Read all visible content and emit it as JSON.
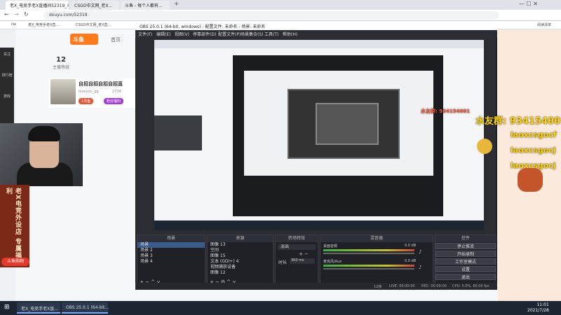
{
  "browser": {
    "tabs": [
      "老X_电竞手老X直播间52319_斗...",
      "CSGO中文网_老X...",
      "斗鱼 - 每个人都有..."
    ],
    "new_tab": "+",
    "url": "douyu.com/52319",
    "bookmarks": [
      "ilw",
      "老X_电竞手老X直...",
      "CSGO中文网_老X直..."
    ],
    "reading_list": "阅读清单"
  },
  "site": {
    "logo": "斗鱼",
    "nav": [
      "首页"
    ],
    "sidebar": [
      "关注",
      "排行榜",
      "游戏"
    ],
    "stats": [
      {
        "value": "12",
        "label": "主播等级"
      }
    ],
    "card_title": "自招自招自招自招直",
    "card_sub": "loveyou_gg",
    "card_count": "2734",
    "card_btn": "1月鱼",
    "card_btn2": "粉丝福利",
    "banner_text": "老X电竞外设店",
    "banner_text2": "专属福利",
    "shop_label": "斗鱼购物",
    "right_buttons": [
      "粉丝图片"
    ]
  },
  "obs": {
    "title": "OBS 25.0.1 (64-bit, windows) - 配置文件: 未命名 - 场景: 未命名",
    "menu": [
      "文件(F)",
      "编辑(E)",
      "视图(V)",
      "停靠部件(D)",
      "配置文件(P)",
      "场景集合(S)",
      "工具(T)",
      "帮助(H)"
    ],
    "docks": {
      "scenes": {
        "title": "场景",
        "items": [
          "场景",
          "场景 2",
          "场景 3",
          "场景 4"
        ]
      },
      "sources": {
        "title": "来源",
        "items": [
          "图像 13",
          "空间",
          "图像 15",
          "文本 (GDI+) 4",
          "视频捕获设备",
          "图像 12"
        ]
      },
      "transitions": {
        "title": "转场特效",
        "type": "淡出",
        "duration_label": "时长",
        "duration": "300 ms"
      },
      "mixer": {
        "title": "混音器",
        "channels": [
          "桌面音频",
          "麦克风/Aux"
        ],
        "level": "0.0 dB"
      },
      "controls": {
        "title": "控件",
        "buttons": [
          "停止推流",
          "开始录制",
          "工作室模式",
          "设置",
          "退出"
        ]
      }
    },
    "status": {
      "live": "LIVE: 00:00:00",
      "rec": "REC: 00:00:00",
      "cpu": "CPU: 5.0%, 60.00 fps",
      "dropped": "12帧"
    }
  },
  "overlay": {
    "danmaku": [
      "水友群: 934154001",
      "水友群: 934154001",
      "laoxcsgocf",
      "laoxcsgocj",
      "laoxcsgocj"
    ]
  },
  "taskbar": {
    "apps": [
      "老X_电竞手老X直...",
      "OBS 25.0.1 (64-bit..."
    ],
    "time": "11:01",
    "date": "2021/7/28"
  }
}
